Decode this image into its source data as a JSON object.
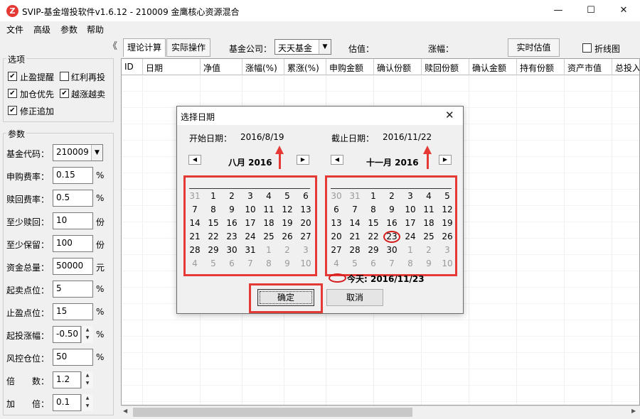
{
  "window": {
    "title": "SVIP-基金增投软件v1.6.12 - 210009 金鹰核心资源混合",
    "logo_letter": "Z",
    "controls": {
      "minimize": "—",
      "maximize": "☐",
      "close": "✕"
    }
  },
  "menu": {
    "items": [
      "文件",
      "高级",
      "参数",
      "帮助"
    ]
  },
  "left_panel": {
    "collapse_glyph": "《",
    "options": {
      "title": "选项",
      "checkboxes": [
        {
          "label": "止盈提醒",
          "checked": true
        },
        {
          "label": "红利再投",
          "checked": false
        },
        {
          "label": "加仓优先",
          "checked": true
        },
        {
          "label": "越涨越卖",
          "checked": true
        },
        {
          "label": "修正追加",
          "checked": true
        }
      ]
    },
    "params": {
      "title": "参数",
      "fund_code": {
        "label": "基金代码：",
        "value": "210009",
        "dropdown": "▼"
      },
      "rows": [
        {
          "label": "申购费率：",
          "value": "0.15",
          "unit": "%"
        },
        {
          "label": "赎回费率：",
          "value": "0.5",
          "unit": "%"
        },
        {
          "label": "至少赎回：",
          "value": "10",
          "unit": "份"
        },
        {
          "label": "至少保留：",
          "value": "100",
          "unit": "份"
        },
        {
          "label": "资金总量：",
          "value": "50000",
          "unit": "元"
        },
        {
          "label": "起卖点位：",
          "value": "5",
          "unit": "%"
        },
        {
          "label": "止盈点位：",
          "value": "15",
          "unit": "%"
        },
        {
          "label": "起投涨幅：",
          "value": "-0.50",
          "unit": "%"
        },
        {
          "label": "风控仓位：",
          "value": "50",
          "unit": "%"
        },
        {
          "label": "倍　　数：",
          "value": "1.2",
          "unit": ""
        },
        {
          "label": "加　　倍：",
          "value": "0.1",
          "unit": ""
        }
      ]
    }
  },
  "toolbar": {
    "tab_theory": "理论计算",
    "tab_actual": "实际操作",
    "company_label": "基金公司：",
    "company_value": "天天基金",
    "estimate_label": "估值：",
    "change_label": "涨幅：",
    "realtime_button": "实时估值",
    "linechart_label": "折线图"
  },
  "grid": {
    "columns": [
      "ID",
      "日期",
      "净值",
      "涨幅(%)",
      "累涨(%)",
      "申购金额",
      "确认份额",
      "赎回份额",
      "确认金额",
      "持有份额",
      "资产市值",
      "总投入"
    ]
  },
  "dialog": {
    "title": "选择日期",
    "close_glyph": "✕",
    "start_label": "开始日期：",
    "start_value": "2016/8/19",
    "end_label": "截止日期：",
    "end_value": "2016/11/22",
    "prev_glyph": "◀",
    "next_glyph": "▶",
    "left_calendar": {
      "month_title": "八月 2016",
      "days": [
        {
          "d": "31",
          "other": true
        },
        {
          "d": "1"
        },
        {
          "d": "2"
        },
        {
          "d": "3"
        },
        {
          "d": "4"
        },
        {
          "d": "5"
        },
        {
          "d": "6"
        },
        {
          "d": "7"
        },
        {
          "d": "8"
        },
        {
          "d": "9"
        },
        {
          "d": "10"
        },
        {
          "d": "11"
        },
        {
          "d": "12"
        },
        {
          "d": "13"
        },
        {
          "d": "14"
        },
        {
          "d": "15"
        },
        {
          "d": "16"
        },
        {
          "d": "17"
        },
        {
          "d": "18"
        },
        {
          "d": "19"
        },
        {
          "d": "20"
        },
        {
          "d": "21"
        },
        {
          "d": "22"
        },
        {
          "d": "23"
        },
        {
          "d": "24"
        },
        {
          "d": "25"
        },
        {
          "d": "26"
        },
        {
          "d": "27"
        },
        {
          "d": "28"
        },
        {
          "d": "29"
        },
        {
          "d": "30"
        },
        {
          "d": "31"
        },
        {
          "d": "1",
          "other": true
        },
        {
          "d": "2",
          "other": true
        },
        {
          "d": "3",
          "other": true
        },
        {
          "d": "4",
          "other": true
        },
        {
          "d": "5",
          "other": true
        },
        {
          "d": "6",
          "other": true
        },
        {
          "d": "7",
          "other": true
        },
        {
          "d": "8",
          "other": true
        },
        {
          "d": "9",
          "other": true
        },
        {
          "d": "10",
          "other": true
        }
      ]
    },
    "right_calendar": {
      "month_title": "十一月 2016",
      "days": [
        {
          "d": "30",
          "other": true
        },
        {
          "d": "31",
          "other": true
        },
        {
          "d": "1"
        },
        {
          "d": "2"
        },
        {
          "d": "3"
        },
        {
          "d": "4"
        },
        {
          "d": "5"
        },
        {
          "d": "6"
        },
        {
          "d": "7"
        },
        {
          "d": "8"
        },
        {
          "d": "9"
        },
        {
          "d": "10"
        },
        {
          "d": "11"
        },
        {
          "d": "12"
        },
        {
          "d": "13"
        },
        {
          "d": "14"
        },
        {
          "d": "15"
        },
        {
          "d": "16"
        },
        {
          "d": "17"
        },
        {
          "d": "18"
        },
        {
          "d": "19"
        },
        {
          "d": "20"
        },
        {
          "d": "21"
        },
        {
          "d": "22"
        },
        {
          "d": "23",
          "circled": true
        },
        {
          "d": "24"
        },
        {
          "d": "25"
        },
        {
          "d": "26"
        },
        {
          "d": "27"
        },
        {
          "d": "28"
        },
        {
          "d": "29"
        },
        {
          "d": "30"
        },
        {
          "d": "1",
          "other": true
        },
        {
          "d": "2",
          "other": true
        },
        {
          "d": "3",
          "other": true
        },
        {
          "d": "4",
          "other": true
        },
        {
          "d": "5",
          "other": true
        },
        {
          "d": "6",
          "other": true
        },
        {
          "d": "7",
          "other": true
        },
        {
          "d": "8",
          "other": true
        },
        {
          "d": "9",
          "other": true
        },
        {
          "d": "10",
          "other": true
        }
      ]
    },
    "today_text": "今天: 2016/11/23",
    "ok_button": "确定",
    "cancel_button": "取消"
  },
  "colors": {
    "annotation_red": "#e53935",
    "logo_red": "#e53935"
  }
}
